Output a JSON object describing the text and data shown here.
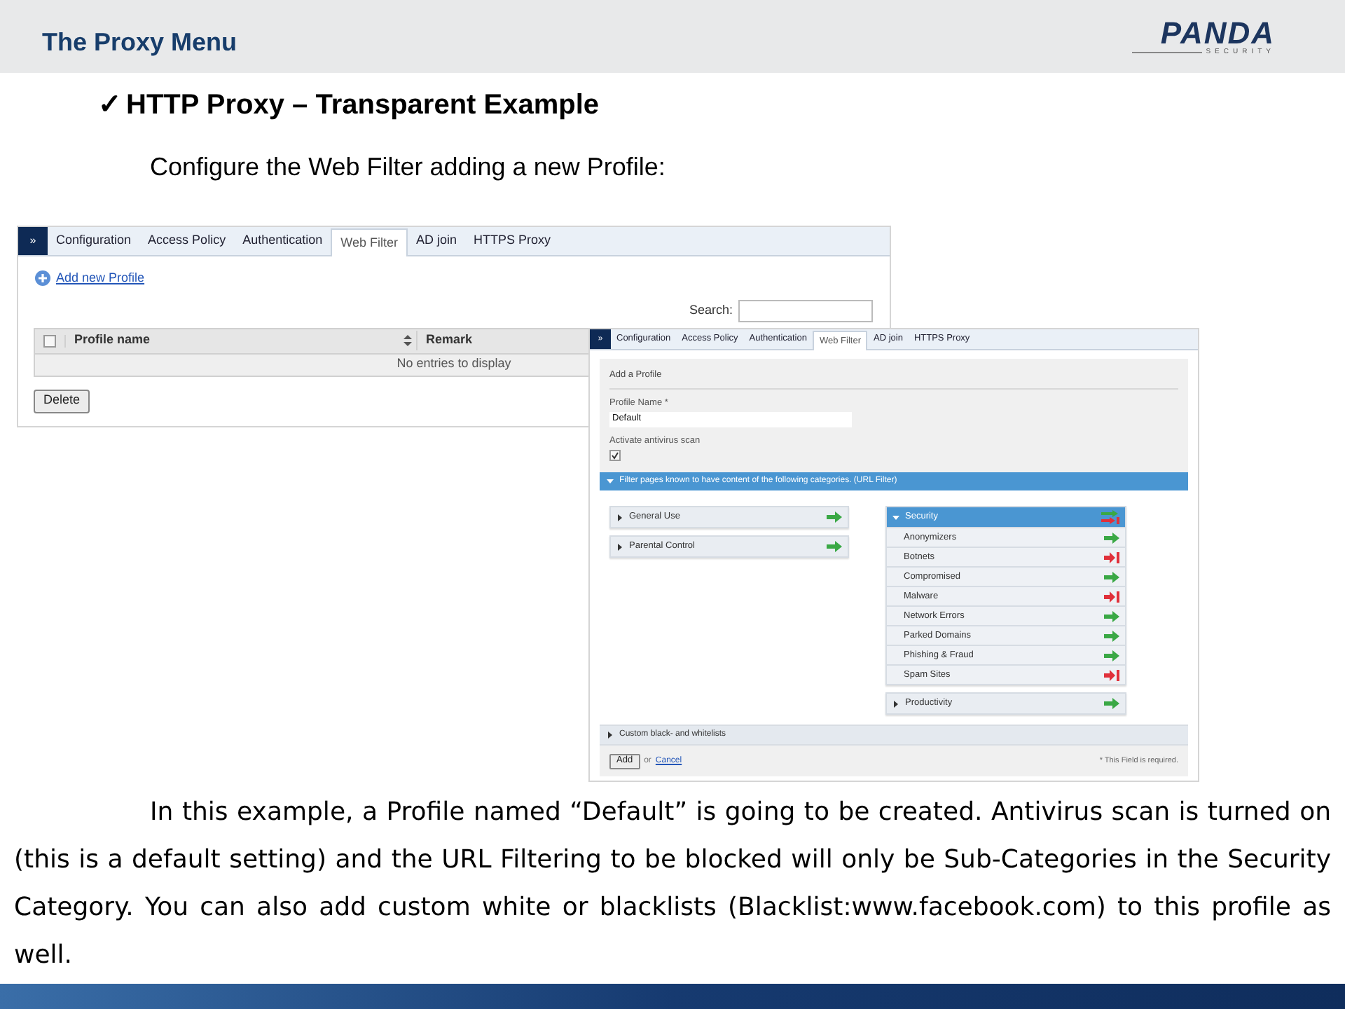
{
  "header": {
    "title": "The Proxy Menu",
    "logo": {
      "name": "PANDA",
      "tagline": "SECURITY"
    }
  },
  "heading": {
    "check": "✓",
    "text": "HTTP Proxy – Transparent Example"
  },
  "intro": "Configure the Web Filter adding a new Profile:",
  "list_screen": {
    "menu_toggle": "»",
    "tabs": [
      {
        "label": "Configuration",
        "selected": false
      },
      {
        "label": "Access Policy",
        "selected": false
      },
      {
        "label": "Authentication",
        "selected": false
      },
      {
        "label": "Web Filter",
        "selected": true
      },
      {
        "label": "AD join",
        "selected": false
      },
      {
        "label": "HTTPS Proxy",
        "selected": false
      }
    ],
    "add_link": "Add new Profile",
    "search_label": "Search:",
    "table": {
      "columns": [
        "Profile name",
        "Remark"
      ],
      "select_all": {
        "checked": false
      },
      "empty_message": "No entries to display"
    },
    "delete_button": "Delete"
  },
  "form_screen": {
    "menu_toggle": "»",
    "tabs": [
      {
        "label": "Configuration",
        "selected": false
      },
      {
        "label": "Access Policy",
        "selected": false
      },
      {
        "label": "Authentication",
        "selected": false
      },
      {
        "label": "Web Filter",
        "selected": true
      },
      {
        "label": "AD join",
        "selected": false
      },
      {
        "label": "HTTPS Proxy",
        "selected": false
      }
    ],
    "section_title": "Add a Profile",
    "profile_name": {
      "label": "Profile Name *",
      "value": "Default"
    },
    "antivirus": {
      "label": "Activate antivirus scan",
      "checked": true
    },
    "filter_bar": {
      "label": "Filter pages known to have content of the following categories. (URL Filter)",
      "expanded": true
    },
    "left_groups": [
      {
        "label": "General Use",
        "expanded": false,
        "kind": "allow"
      },
      {
        "label": "Parental Control",
        "expanded": false,
        "kind": "allow"
      }
    ],
    "right_groups": [
      {
        "label": "Security",
        "expanded": true,
        "kind": "mixed",
        "children": [
          {
            "label": "Anonymizers",
            "kind": "allow"
          },
          {
            "label": "Botnets",
            "kind": "block"
          },
          {
            "label": "Compromised",
            "kind": "allow"
          },
          {
            "label": "Malware",
            "kind": "block"
          },
          {
            "label": "Network Errors",
            "kind": "allow"
          },
          {
            "label": "Parked Domains",
            "kind": "allow"
          },
          {
            "label": "Phishing & Fraud",
            "kind": "allow"
          },
          {
            "label": "Spam Sites",
            "kind": "block"
          }
        ]
      },
      {
        "label": "Productivity",
        "expanded": false,
        "kind": "allow"
      }
    ],
    "custom_lists": {
      "label": "Custom black- and whitelists",
      "expanded": false
    },
    "add_button": "Add",
    "or_text": "or",
    "cancel_link": "Cancel",
    "required_note": "* This Field is required."
  },
  "body": "In this example, a Profile named “Default” is going to be created. Antivirus scan is turned on (this is a default setting) and the URL Filtering to be blocked will only be Sub-Categories in the Security Category.  You can also add custom white or blacklists (Blacklist:www.facebook.com) to this profile as well."
}
